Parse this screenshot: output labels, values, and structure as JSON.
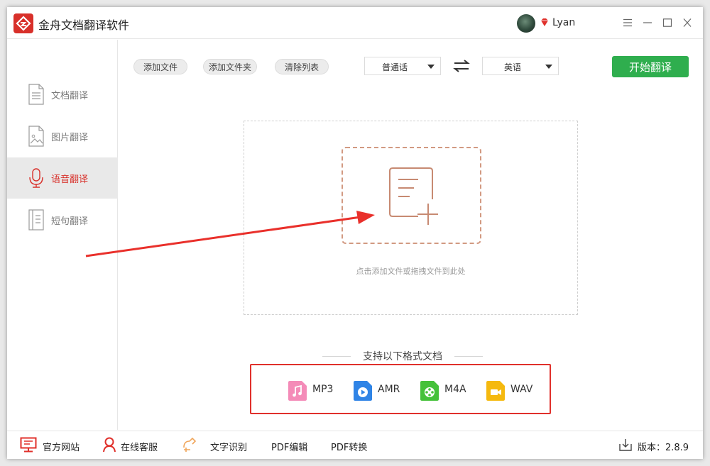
{
  "app": {
    "title": "金舟文档翻译软件",
    "accent": "#d8302a"
  },
  "user": {
    "name": "Lyan"
  },
  "window_controls": {
    "menu": "☰",
    "minimize": "—",
    "maximize": "☐",
    "close": "✕"
  },
  "sidebar": {
    "items": [
      {
        "label": "文档翻译",
        "icon": "document-icon",
        "active": false
      },
      {
        "label": "图片翻译",
        "icon": "image-icon",
        "active": false
      },
      {
        "label": "语音翻译",
        "icon": "microphone-icon",
        "active": true
      },
      {
        "label": "短句翻译",
        "icon": "notebook-icon",
        "active": false
      }
    ]
  },
  "toolbar": {
    "add_file": "添加文件",
    "add_folder": "添加文件夹",
    "clear_list": "清除列表",
    "source_lang": "普通话",
    "target_lang": "英语",
    "start": "开始翻译",
    "start_color": "#2fae4e"
  },
  "dropzone": {
    "hint": "点击添加文件或拖拽文件到此处"
  },
  "formats": {
    "title": "支持以下格式文档",
    "items": [
      {
        "label": "MP3",
        "icon": "music-file-icon",
        "color": "#f48bb8"
      },
      {
        "label": "AMR",
        "icon": "play-file-icon",
        "color": "#2f84e6"
      },
      {
        "label": "M4A",
        "icon": "reel-file-icon",
        "color": "#45c13a"
      },
      {
        "label": "WAV",
        "icon": "video-file-icon",
        "color": "#f5b90f"
      }
    ]
  },
  "statusbar": {
    "website": "官方网站",
    "support": "在线客服",
    "ocr": "文字识别",
    "pdf_edit": "PDF编辑",
    "pdf_convert": "PDF转换",
    "version": "版本：2.8.9"
  }
}
